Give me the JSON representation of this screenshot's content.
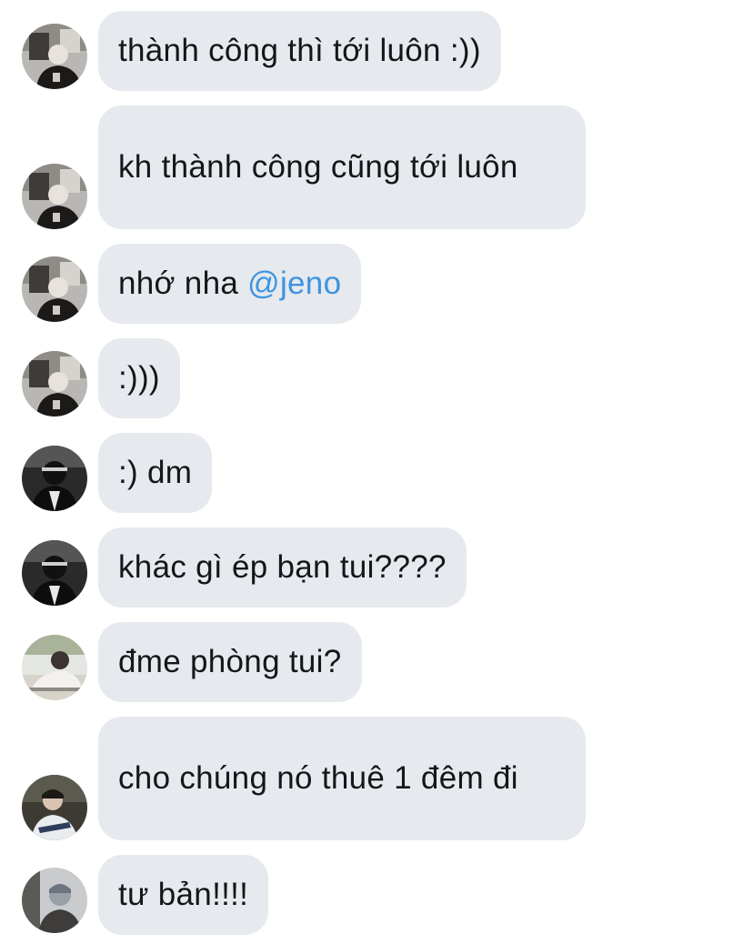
{
  "messages": [
    {
      "text": "thành công thì tới luôn :))",
      "avatar": "avatar-a"
    },
    {
      "text": "kh thành công cũng tới luôn",
      "avatar": "avatar-a"
    },
    {
      "text": "nhớ nha ",
      "mention": "@jeno",
      "avatar": "avatar-a"
    },
    {
      "text": ":)))",
      "avatar": "avatar-a"
    },
    {
      "text": ":) dm",
      "avatar": "avatar-b"
    },
    {
      "text": "khác gì ép bạn tui????",
      "avatar": "avatar-b"
    },
    {
      "text": "đme phòng tui?",
      "avatar": "avatar-c"
    },
    {
      "text": "cho chúng nó thuê 1 đêm đi",
      "avatar": "avatar-d"
    },
    {
      "text": "tư bản!!!!",
      "avatar": "avatar-e"
    }
  ],
  "colors": {
    "bubble": "#e6e9ed",
    "text": "#14171a",
    "mention": "#3d94e0",
    "background": "#ffffff"
  }
}
